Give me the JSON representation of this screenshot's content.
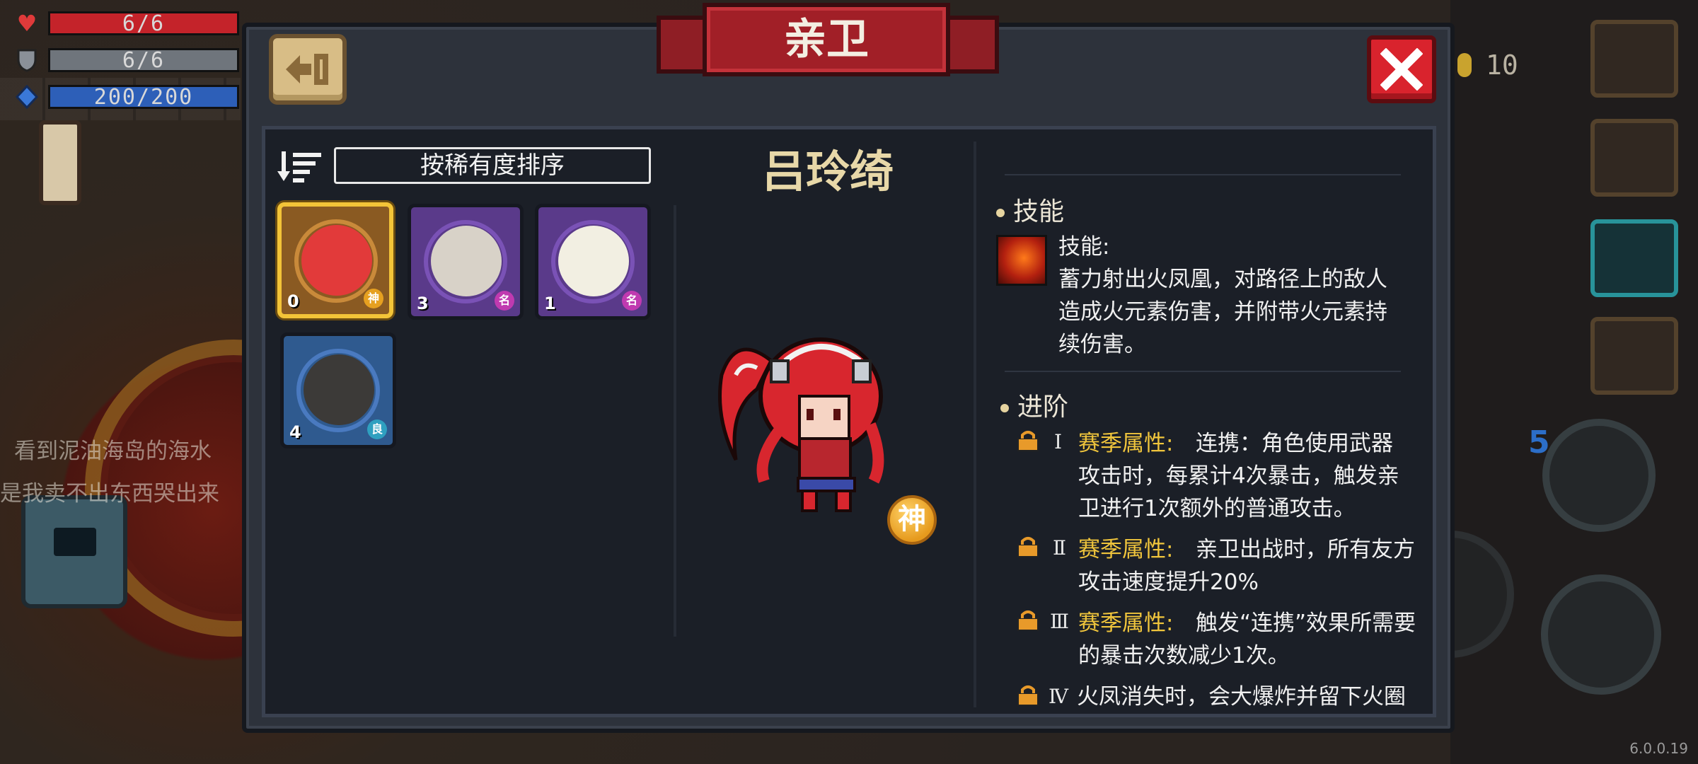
{
  "hud": {
    "hp": "6/6",
    "armor": "6/6",
    "energy": "200/200",
    "coins": "10",
    "level_indicator": "5",
    "version": "6.0.0.19"
  },
  "background_chat": [
    "看到泥油海岛的海水",
    "是我卖不出东西哭出来"
  ],
  "panel": {
    "title": "亲卫",
    "sort_label": "按稀有度排序"
  },
  "guards": [
    {
      "count": "0",
      "rarity": "神",
      "selected": true,
      "bg": "#8a5a22",
      "ring": "#c98a3a",
      "face": "#e23a3a",
      "badge_color": "#e6a020"
    },
    {
      "count": "3",
      "rarity": "名",
      "selected": false,
      "bg": "#5a3a8a",
      "ring": "#7a52b6",
      "face": "#d8d2c8",
      "badge_color": "#c03ab0"
    },
    {
      "count": "1",
      "rarity": "名",
      "selected": false,
      "bg": "#5a3a8a",
      "ring": "#7a52b6",
      "face": "#f2efe2",
      "badge_color": "#c03ab0"
    },
    {
      "count": "4",
      "rarity": "良",
      "selected": false,
      "bg": "#2f5a8f",
      "ring": "#4a7ac0",
      "face": "#3c3a38",
      "badge_color": "#2fa0c0"
    }
  ],
  "character": {
    "name": "吕玲绮",
    "rarity_badge": "神"
  },
  "details": {
    "skill_heading": "技能",
    "skill_label": "技能:",
    "skill_lines": [
      "蓄力射出火凤凰，对路径上的敌人",
      "造成火元素伤害，并附带火元素持",
      "续伤害。"
    ],
    "advance_heading": "进阶",
    "advances": [
      {
        "tier": "Ⅰ",
        "tag": "赛季属性:",
        "lines": [
          "连携：角色使用武器",
          "攻击时，每累计4次暴击，触发亲",
          "卫进行1次额外的普通攻击。"
        ]
      },
      {
        "tier": "Ⅱ",
        "tag": "赛季属性:",
        "lines": [
          "亲卫出战时，所有友方",
          "攻击速度提升20%"
        ]
      },
      {
        "tier": "Ⅲ",
        "tag": "赛季属性:",
        "lines": [
          "触发“连携”效果所需要",
          "的暴击次数减少1次。"
        ]
      },
      {
        "tier": "Ⅳ",
        "tag": "",
        "lines": [
          "火凤消失时，会大爆炸并留下火圈"
        ]
      }
    ]
  }
}
